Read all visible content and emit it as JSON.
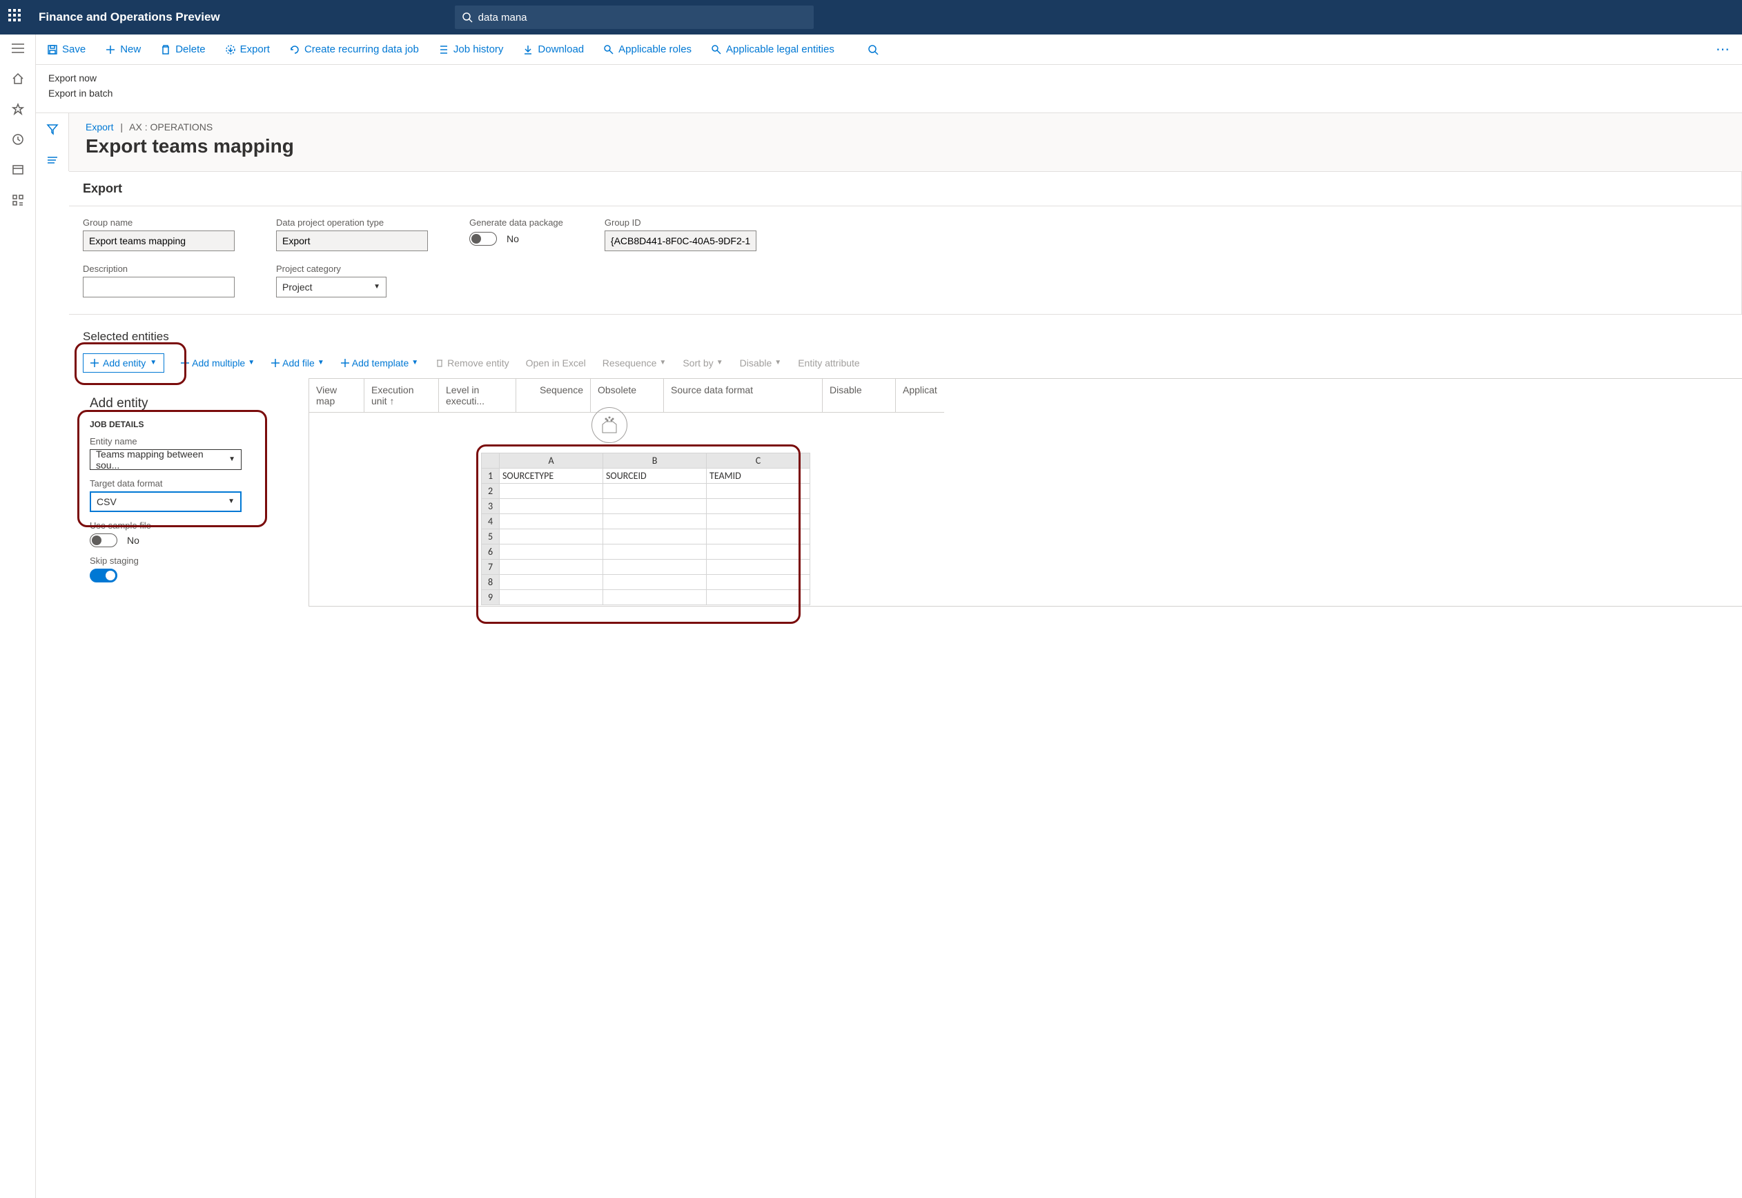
{
  "header": {
    "app_title": "Finance and Operations Preview",
    "search_value": "data mana"
  },
  "commands": {
    "save": "Save",
    "new": "New",
    "delete": "Delete",
    "export": "Export",
    "create_recurring": "Create recurring data job",
    "job_history": "Job history",
    "download": "Download",
    "applicable_roles": "Applicable roles",
    "applicable_legal_entities": "Applicable legal entities"
  },
  "sublinks": {
    "export_now": "Export now",
    "export_in_batch": "Export in batch"
  },
  "breadcrumb": {
    "export": "Export",
    "path": "AX : OPERATIONS"
  },
  "page_title": "Export teams mapping",
  "export_section": {
    "title": "Export",
    "group_name_label": "Group name",
    "group_name_value": "Export teams mapping",
    "description_label": "Description",
    "description_value": "",
    "operation_type_label": "Data project operation type",
    "operation_type_value": "Export",
    "project_category_label": "Project category",
    "project_category_value": "Project",
    "generate_package_label": "Generate data package",
    "generate_package_value": "No",
    "group_id_label": "Group ID",
    "group_id_value": "{ACB8D441-8F0C-40A5-9DF2-1..."
  },
  "selected_entities": {
    "title": "Selected entities",
    "add_entity": "Add entity",
    "add_multiple": "Add multiple",
    "add_file": "Add file",
    "add_template": "Add template",
    "remove_entity": "Remove entity",
    "open_in_excel": "Open in Excel",
    "resequence": "Resequence",
    "sort_by": "Sort by",
    "disable": "Disable",
    "entity_attribute": "Entity attribute"
  },
  "table_columns": {
    "view_map": "View map",
    "execution_unit": "Execution unit",
    "level": "Level in executi...",
    "sequence": "Sequence",
    "obsolete": "Obsolete",
    "source_format": "Source data format",
    "disable": "Disable",
    "application": "Applicat"
  },
  "flyout": {
    "title": "Add entity",
    "section": "JOB DETAILS",
    "entity_name_label": "Entity name",
    "entity_name_value": "Teams mapping between sou...",
    "target_format_label": "Target data format",
    "target_format_value": "CSV",
    "use_sample_label": "Use sample file",
    "use_sample_value": "No",
    "skip_staging_label": "Skip staging"
  },
  "spreadsheet": {
    "cols": [
      "A",
      "B",
      "C"
    ],
    "headers": [
      "SOURCETYPE",
      "SOURCEID",
      "TEAMID"
    ],
    "rows": [
      "1",
      "2",
      "3",
      "4",
      "5",
      "6",
      "7",
      "8",
      "9"
    ]
  }
}
